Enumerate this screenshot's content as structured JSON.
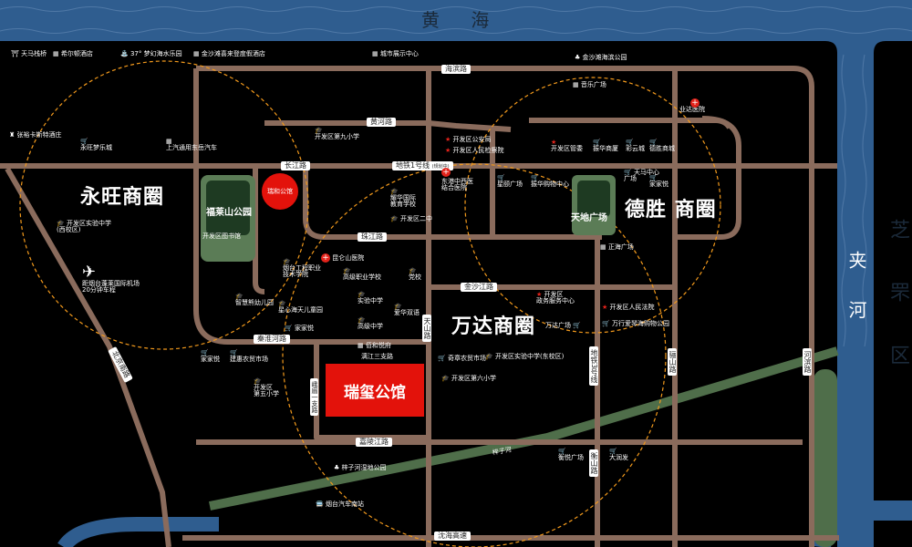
{
  "seas": {
    "huanghai": "黄 海",
    "zhifu_district": "芝 罘 区",
    "jiahe_river": "夹 河"
  },
  "districts": {
    "yongwang": "永旺商圈",
    "desheng": "德胜 商圈",
    "wanda": "万达商圈"
  },
  "roads": {
    "haibin": "海滨路",
    "huanghe": "黄河路",
    "changjiang": "长江路",
    "metro1": "地铁1号线",
    "metro1_note": "(规划中)",
    "zhujiang": "珠江路",
    "jinshajiang": "金沙江路",
    "qinhuaihe": "秦淮河路",
    "tianshan": "天山路",
    "metro3": "地铁3号线",
    "metro3_note": "(规划中)",
    "hengshan": "衡山路",
    "lishan": "骊山路",
    "hebin": "河滨路",
    "emei": "峨眉一支路",
    "jialingjiang": "嘉陵江路",
    "shenhai": "沈海高速",
    "beijing": "北京南路",
    "lijiang3": "漓江三支路",
    "zishui": "梓子河"
  },
  "project": {
    "name": "瑞玺公馆",
    "logo": "瑞玺"
  },
  "landmark_red": "瑞和公馆",
  "parks": {
    "fulaishan": "福莱山公园",
    "tiandi": "天地广场"
  },
  "top_pois": [
    "天马栈桥",
    "希尔顿酒店",
    "37° 梦幻海水乐园",
    "金沙滩喜来登度假酒店",
    "城市展示中心",
    "金沙滩海滨公园"
  ],
  "pois": {
    "zhangyu": "张裕卡斯特酒庄",
    "yongwang_mart": "永旺梦乐城",
    "saic": "上汽通用东岳汽车",
    "school_kfq_west": "开发区实验中学\n(西校区)",
    "airport": "距烟台蓬莱国际机场\n20分钟车程",
    "xiaoxue9": "开发区第九小学",
    "gongan": "开发区公安局",
    "jianchayuan": "开发区人民检察院",
    "gongren": "开发区管委",
    "zhenhua": "振华商厦",
    "caiyun": "彩云城",
    "desheng_mall": "德胜商城",
    "yinyue": "音乐广场",
    "yeshengyiyuan": "业达医院",
    "dongfang": "东港中西医\n结合医院",
    "yaohua": "耀华国际\n教育学校",
    "erzhong": "开发区二中",
    "xingyue": "星颐广场",
    "zhenhua_gouwu": "振华购物中心",
    "tianma": "天马中心\n广场",
    "jiajiayue": "家家悦",
    "zhenghai": "正海广场",
    "library": "开发区图书馆",
    "kunlun": "昆仑山医院",
    "yantai_gongcheng": "烟台工程职业\n技术学院",
    "gaoji": "高级职业学校",
    "danxiao": "党校",
    "zhihui": "智慧熊幼儿园",
    "lingxin": "星心海天儿童园",
    "jiajiayue2": "家家悦",
    "shiyan": "实验中学",
    "aihua": "爱华双语",
    "gaoxin": "高级中学",
    "zhengwu": "开发区\n政务服务中心",
    "renmin_fayuan": "开发区人民法院",
    "wanda_plaza": "万达广场",
    "wanxing": "万行爱琴海购物公园",
    "xinhe": "佰和悦府",
    "jiajiayue3": "家家悦",
    "jiayuan": "建惠农贸市场",
    "xiaoxue5": "开发区\n第五小学",
    "qizhang": "奇章农贸市场",
    "shiyan_east": "开发区实验中学(东校区)",
    "xiaoxue6": "开发区第六小学",
    "hengyue": "衡悦广场",
    "darunfa": "大润发",
    "zhizi_park": "梓子河湿地公园",
    "station": "烟台汽车南站"
  },
  "colors": {
    "background": "#000000",
    "sea": "#2f5d8f",
    "road": "#8a6b5c",
    "accent_red": "#e3120b",
    "school": "#f39a1c",
    "circle": "#f39a1c",
    "park": "#5b7c56"
  }
}
